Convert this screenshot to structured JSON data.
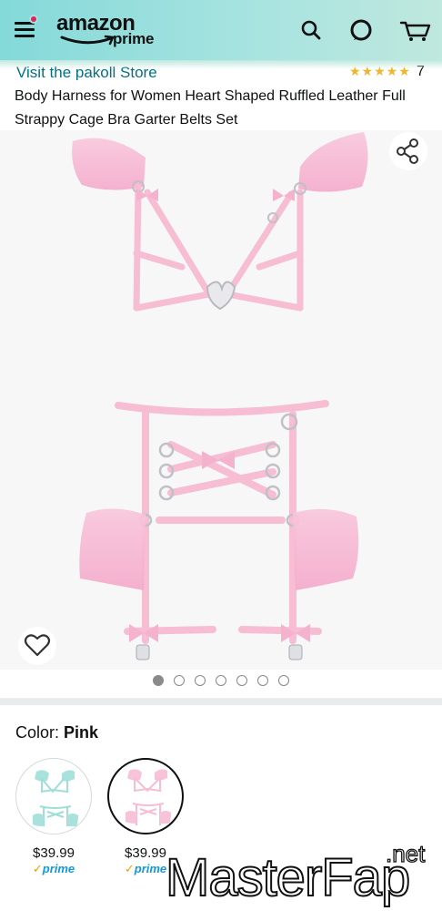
{
  "header": {
    "logo_word": "amazon",
    "logo_prime": "prime",
    "icons": [
      "menu-icon",
      "search-icon",
      "alexa-icon",
      "cart-icon"
    ]
  },
  "store": {
    "link_text": "Visit the pakoll Store",
    "stars": "★★★★★",
    "rating_count": "7"
  },
  "product": {
    "title": "Body Harness for Women Heart Shaped Ruffled Leather Full Strappy Cage Bra Garter Belts Set",
    "image_count": 7,
    "active_image_index": 0
  },
  "variation": {
    "label": "Color:",
    "selected": "Pink",
    "swatches": [
      {
        "name": "Blue",
        "price": "$39.99",
        "prime": "prime",
        "selected": false
      },
      {
        "name": "Pink",
        "price": "$39.99",
        "prime": "prime",
        "selected": true
      }
    ]
  },
  "watermark": {
    "text": "MasterFap",
    "suffix": ".net"
  },
  "colors": {
    "header_start": "#84d9d9",
    "header_end": "#bfe8de",
    "link": "#007185",
    "prime_blue": "#1399d6",
    "harness_pink": "#f6bdd3"
  }
}
